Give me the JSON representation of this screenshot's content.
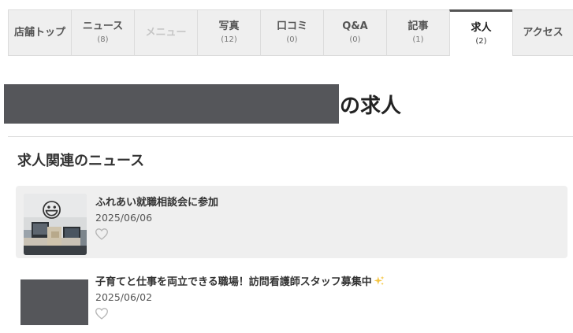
{
  "tabs": [
    {
      "label": "店舗トップ",
      "count": "",
      "state": "normal"
    },
    {
      "label": "ニュース",
      "count": "(8)",
      "state": "normal"
    },
    {
      "label": "メニュー",
      "count": "",
      "state": "disabled"
    },
    {
      "label": "写真",
      "count": "(12)",
      "state": "normal"
    },
    {
      "label": "口コミ",
      "count": "(0)",
      "state": "normal"
    },
    {
      "label": "Q&A",
      "count": "(0)",
      "state": "normal"
    },
    {
      "label": "記事",
      "count": "(1)",
      "state": "normal"
    },
    {
      "label": "求人",
      "count": "(2)",
      "state": "active"
    },
    {
      "label": "アクセス",
      "count": "",
      "state": "normal"
    }
  ],
  "page": {
    "title_suffix": "の求人",
    "section_title": "求人関連のニュース"
  },
  "news": [
    {
      "headline": "ふれあい就職相談会に参加",
      "date": "2025/06/06",
      "emoji": "😃"
    },
    {
      "headline": "子育てと仕事を両立できる職場！訪問看護師スタッフ募集中",
      "date": "2025/06/02"
    }
  ],
  "colors": {
    "tab_bg": "#efefef",
    "active_tab_border": "#555555",
    "redaction": "#55565a",
    "card_bg": "#efefef",
    "sparkle": "#f5c542"
  },
  "icons": {
    "like": "heart-outline-icon",
    "sparkle": "sparkles-icon"
  }
}
